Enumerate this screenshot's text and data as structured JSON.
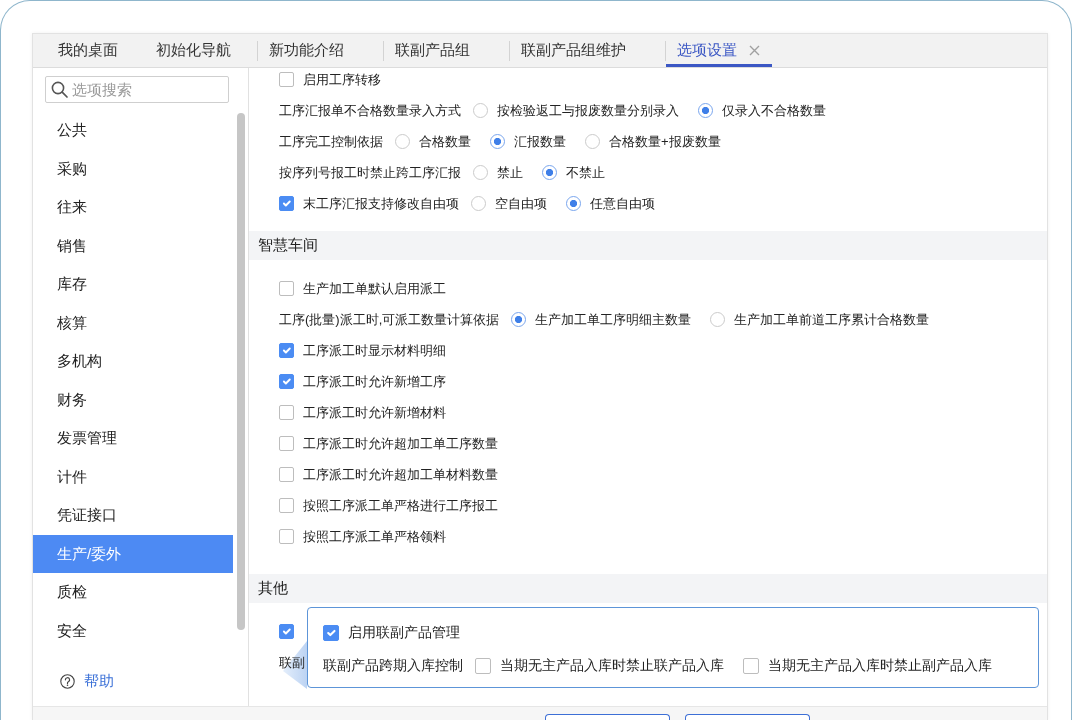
{
  "tabs": [
    {
      "label": "我的桌面",
      "selected": false,
      "pinned": true,
      "closable": false
    },
    {
      "label": "初始化导航",
      "selected": false,
      "pinned": true,
      "closable": false
    },
    {
      "label": "新功能介绍",
      "selected": false,
      "pinned": false,
      "closable": false
    },
    {
      "label": "联副产品组",
      "selected": false,
      "pinned": false,
      "closable": false
    },
    {
      "label": "联副产品组维护",
      "selected": false,
      "pinned": false,
      "closable": false
    },
    {
      "label": "选项设置",
      "selected": true,
      "pinned": false,
      "closable": true
    }
  ],
  "sidebar": {
    "search": {
      "placeholder": "选项搜索"
    },
    "items": [
      {
        "label": "公共",
        "selected": false
      },
      {
        "label": "采购",
        "selected": false
      },
      {
        "label": "往来",
        "selected": false
      },
      {
        "label": "销售",
        "selected": false
      },
      {
        "label": "库存",
        "selected": false
      },
      {
        "label": "核算",
        "selected": false
      },
      {
        "label": "多机构",
        "selected": false
      },
      {
        "label": "财务",
        "selected": false
      },
      {
        "label": "发票管理",
        "selected": false
      },
      {
        "label": "计件",
        "selected": false
      },
      {
        "label": "凭证接口",
        "selected": false
      },
      {
        "label": "生产/委外",
        "selected": true
      },
      {
        "label": "质检",
        "selected": false
      },
      {
        "label": "安全",
        "selected": false
      }
    ],
    "help": "帮助"
  },
  "content": {
    "sections": [
      {
        "rows": [
          {
            "kind": "checkbox",
            "label": "启用工序转移",
            "checked": false
          },
          {
            "kind": "radio",
            "label": "工序汇报单不合格数量录入方式",
            "options": [
              {
                "label": "按检验返工与报废数量分别录入",
                "selected": false
              },
              {
                "label": "仅录入不合格数量",
                "selected": true
              }
            ]
          },
          {
            "kind": "radio",
            "label": "工序完工控制依据",
            "options": [
              {
                "label": "合格数量",
                "selected": false
              },
              {
                "label": "汇报数量",
                "selected": true
              },
              {
                "label": "合格数量+报废数量",
                "selected": false
              }
            ]
          },
          {
            "kind": "radio",
            "label": "按序列号报工时禁止跨工序汇报",
            "options": [
              {
                "label": "禁止",
                "selected": false
              },
              {
                "label": "不禁止",
                "selected": true
              }
            ]
          },
          {
            "kind": "checkbox",
            "label": "末工序汇报支持修改自由项",
            "checked": true,
            "options": [
              {
                "label": "空自由项",
                "selected": false
              },
              {
                "label": "任意自由项",
                "selected": true
              }
            ]
          }
        ]
      },
      {
        "title": "智慧车间",
        "rows": [
          {
            "kind": "checkbox",
            "label": "生产加工单默认启用派工",
            "checked": false
          },
          {
            "kind": "radio",
            "label": "工序(批量)派工时,可派工数量计算依据",
            "options": [
              {
                "label": "生产加工单工序明细主数量",
                "selected": true
              },
              {
                "label": "生产加工单前道工序累计合格数量",
                "selected": false
              }
            ]
          },
          {
            "kind": "checkbox",
            "label": "工序派工时显示材料明细",
            "checked": true
          },
          {
            "kind": "checkbox",
            "label": "工序派工时允许新增工序",
            "checked": true
          },
          {
            "kind": "checkbox",
            "label": "工序派工时允许新增材料",
            "checked": false
          },
          {
            "kind": "checkbox",
            "label": "工序派工时允许超加工单工序数量",
            "checked": false
          },
          {
            "kind": "checkbox",
            "label": "工序派工时允许超加工单材料数量",
            "checked": false
          },
          {
            "kind": "checkbox",
            "label": "按照工序派工单严格进行工序报工",
            "checked": false
          },
          {
            "kind": "checkbox",
            "label": "按照工序派工单严格领料",
            "checked": false
          }
        ]
      },
      {
        "title": "其他",
        "rows": [
          {
            "kind": "checkbox",
            "checked": true
          },
          {
            "kind": "text",
            "label": "联副"
          }
        ]
      }
    ]
  },
  "popover": {
    "rows": [
      {
        "kind": "checkbox",
        "label": "启用联副产品管理",
        "checked": true
      },
      {
        "kind": "checklist",
        "label": "联副产品跨期入库控制",
        "options": [
          {
            "label": "当期无主产品入库时禁止联产品入库",
            "checked": false
          },
          {
            "label": "当期无主产品入库时禁止副产品入库",
            "checked": false
          }
        ]
      }
    ]
  },
  "footer": {
    "buttons": [
      {
        "kind": "outline"
      },
      {
        "kind": "outline"
      }
    ]
  }
}
